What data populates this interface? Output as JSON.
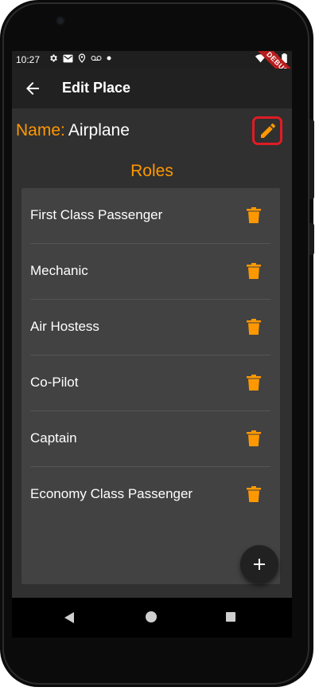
{
  "status_bar": {
    "time": "10:27",
    "icons": [
      "settings-icon",
      "gmail-icon",
      "location-icon",
      "voicemail-icon",
      "dot-icon"
    ],
    "right_icons": [
      "wifi-icon",
      "signal-icon",
      "battery-icon"
    ]
  },
  "debug_banner": "DEBUG",
  "app_bar": {
    "title": "Edit Place",
    "back_icon": "arrow-back-icon"
  },
  "place": {
    "name_label": "Name:",
    "name_value": "Airplane",
    "edit_icon": "pencil-icon"
  },
  "roles": {
    "heading": "Roles",
    "items": [
      {
        "label": "First Class Passenger"
      },
      {
        "label": "Mechanic"
      },
      {
        "label": "Air Hostess"
      },
      {
        "label": "Co-Pilot"
      },
      {
        "label": "Captain"
      },
      {
        "label": "Economy Class Passenger"
      }
    ],
    "delete_icon": "trash-icon"
  },
  "fab": {
    "icon": "plus-icon"
  },
  "navigation": {
    "icons": [
      "nav-back-icon",
      "nav-home-icon",
      "nav-recents-icon"
    ]
  },
  "colors": {
    "accent": "#ff9800",
    "surface": "#303030",
    "card": "#424242",
    "app_bar": "#212121",
    "highlight": "#e01b24",
    "text": "#ffffff"
  }
}
